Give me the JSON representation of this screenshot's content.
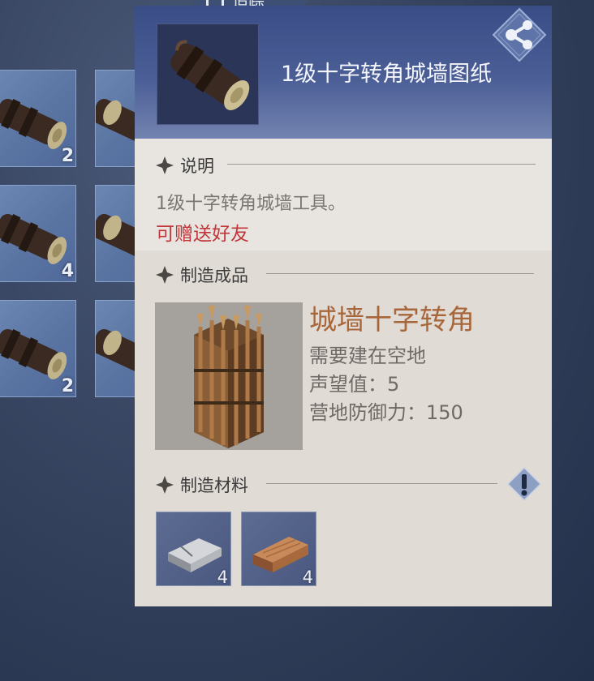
{
  "track_tag": {
    "label": "追踪"
  },
  "inventory": {
    "slots": [
      {
        "count": "2"
      },
      {
        "count": ""
      },
      {
        "count": "4"
      },
      {
        "count": ""
      },
      {
        "count": "2"
      },
      {
        "count": ""
      }
    ]
  },
  "item": {
    "title": "1级十字转角城墙图纸",
    "share_icon": "share-icon"
  },
  "description": {
    "heading": "说明",
    "text": "1级十字转角城墙工具。",
    "gift_note": "可赠送好友"
  },
  "product": {
    "heading": "制造成品",
    "name": "城墙十字转角",
    "requirement": "需要建在空地",
    "prestige": "声望值：5",
    "defense": "营地防御力：150"
  },
  "materials": {
    "heading": "制造材料",
    "items": [
      {
        "name": "iron-ingot",
        "count": "4"
      },
      {
        "name": "wood-plank",
        "count": "4"
      }
    ]
  },
  "colors": {
    "accent_title": "#a8673b",
    "gift_red": "#c1363a",
    "header_blue": "#3a4d86"
  }
}
